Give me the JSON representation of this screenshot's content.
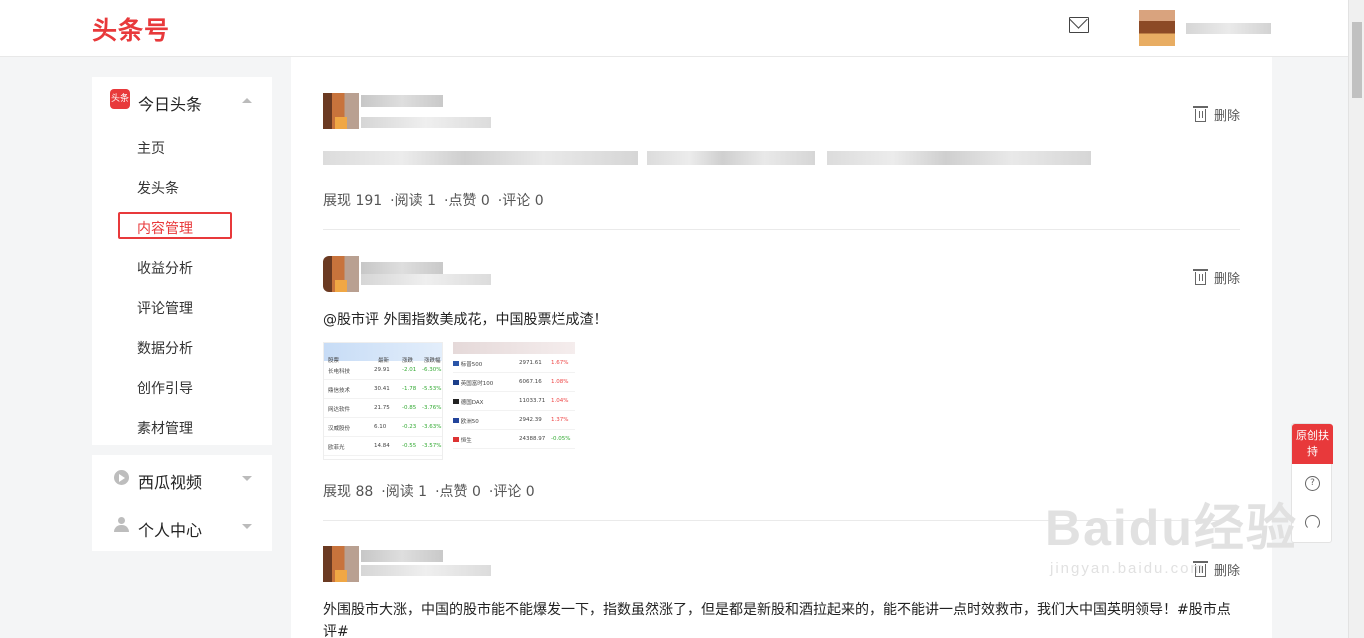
{
  "header": {
    "logo": "头条号",
    "mail_icon": "mail-icon"
  },
  "sidebar": {
    "brand_icon_text": "头条",
    "section_title": "今日头条",
    "items": [
      {
        "label": "主页"
      },
      {
        "label": "发头条"
      },
      {
        "label": "内容管理"
      },
      {
        "label": "收益分析"
      },
      {
        "label": "评论管理"
      },
      {
        "label": "数据分析"
      },
      {
        "label": "创作引导"
      },
      {
        "label": "素材管理"
      }
    ],
    "sections": [
      {
        "label": "西瓜视频"
      },
      {
        "label": "个人中心"
      }
    ]
  },
  "posts": [
    {
      "delete_label": "删除",
      "stats": {
        "views": "展现 191",
        "reads": "阅读 1",
        "likes": "点赞 0",
        "comments": "评论 0"
      }
    },
    {
      "delete_label": "删除",
      "text": "@股市评 外围指数美成花，中国股票烂成渣！",
      "stats": {
        "views": "展现 88",
        "reads": "阅读 1",
        "likes": "点赞 0",
        "comments": "评论 0"
      },
      "image_a": {
        "header": [
          "股票",
          "最新",
          "涨跌",
          "涨跌幅"
        ],
        "rows": [
          {
            "name": "长电科技",
            "price": "29.91",
            "chg": "-2.01",
            "pct": "-6.30%"
          },
          {
            "name": "鼎信技术",
            "price": "30.41",
            "chg": "-1.78",
            "pct": "-5.53%"
          },
          {
            "name": "网达软件",
            "price": "21.75",
            "chg": "-0.85",
            "pct": "-3.76%"
          },
          {
            "name": "汉威股份",
            "price": "6.10",
            "chg": "-0.23",
            "pct": "-3.63%"
          },
          {
            "name": "欧菲光",
            "price": "14.84",
            "chg": "-0.55",
            "pct": "-3.57%"
          }
        ]
      },
      "image_b": {
        "rows": [
          {
            "name": "标普500",
            "price": "2971.61",
            "pct": "1.67%"
          },
          {
            "name": "英国富时100",
            "price": "6067.16",
            "pct": "1.08%"
          },
          {
            "name": "德国DAX",
            "price": "11033.71",
            "pct": "1.04%"
          },
          {
            "name": "欧洲50",
            "price": "2942.39",
            "pct": "1.37%"
          },
          {
            "name": "恒生",
            "price": "24388.97",
            "pct": "-0.05%"
          }
        ]
      }
    },
    {
      "delete_label": "删除",
      "text": "外围股市大涨，中国的股市能不能爆发一下，指数虽然涨了，但是都是新股和酒拉起来的，能不能讲一点时效救市，我们大中国英明领导！#股市点评#"
    }
  ],
  "float_widget": {
    "original_label": "原创扶持",
    "help_icon": "question-icon",
    "service_icon": "headset-icon"
  },
  "watermark": {
    "brand": "Baidu经验",
    "url": "jingyan.baidu.com"
  }
}
